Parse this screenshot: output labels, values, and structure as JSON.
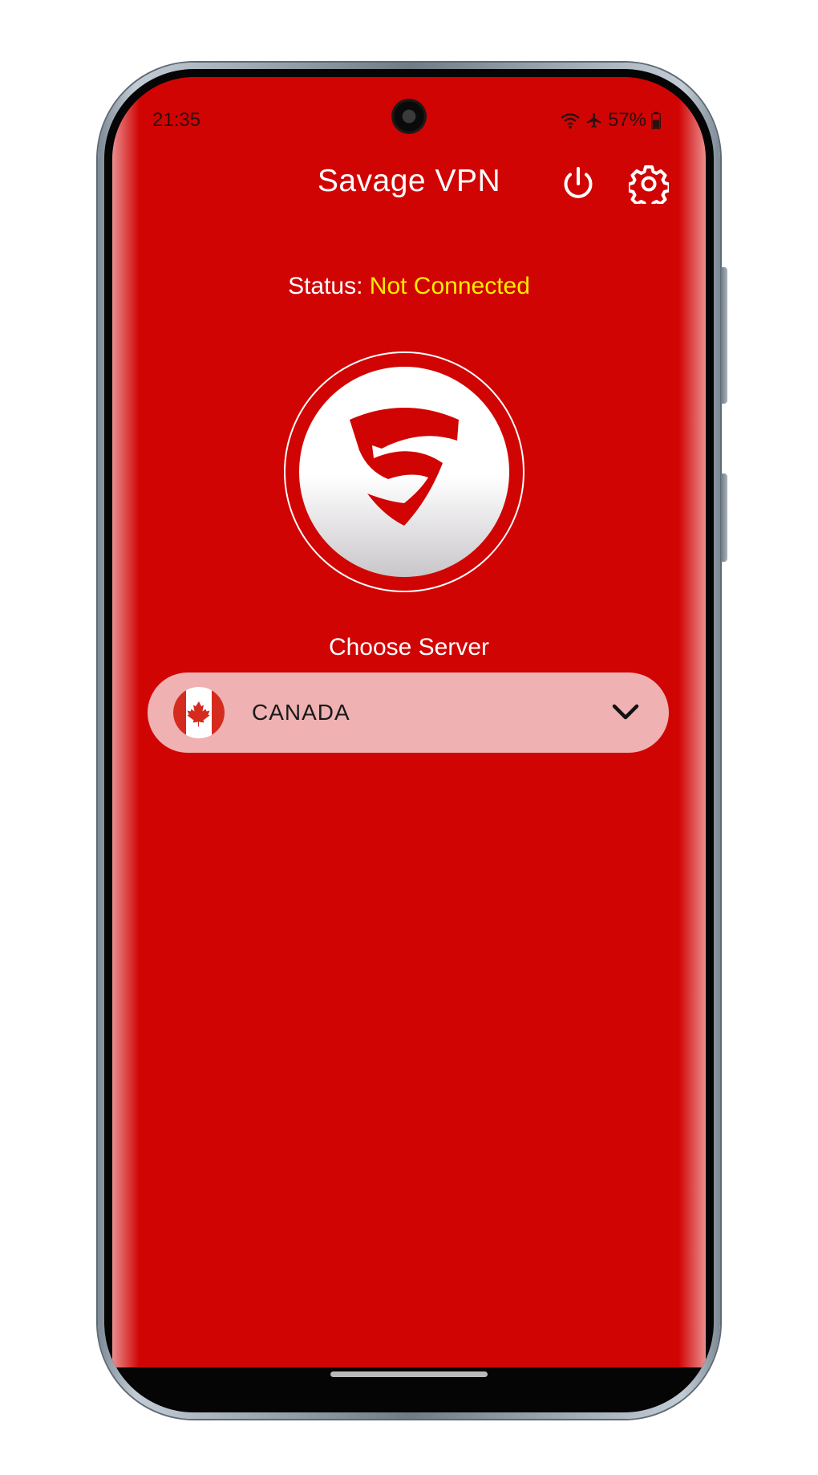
{
  "status_bar": {
    "time": "21:35",
    "battery": "57%",
    "icons": [
      "wifi-icon",
      "airplane-icon",
      "battery-icon"
    ]
  },
  "header": {
    "title": "Savage VPN",
    "power_icon": "power-icon",
    "settings_icon": "gear-icon"
  },
  "connection": {
    "label": "Status: ",
    "value": "Not Connected",
    "value_color": "#ffec00"
  },
  "logo": {
    "icon": "shield-logo"
  },
  "server": {
    "label": "Choose Server",
    "selected": "CANADA",
    "flag_icon": "canada-flag-icon",
    "dropdown_icon": "chevron-down-icon"
  },
  "colors": {
    "background": "#d10404",
    "select_background": "#efb1b1",
    "text": "#ffffff"
  }
}
